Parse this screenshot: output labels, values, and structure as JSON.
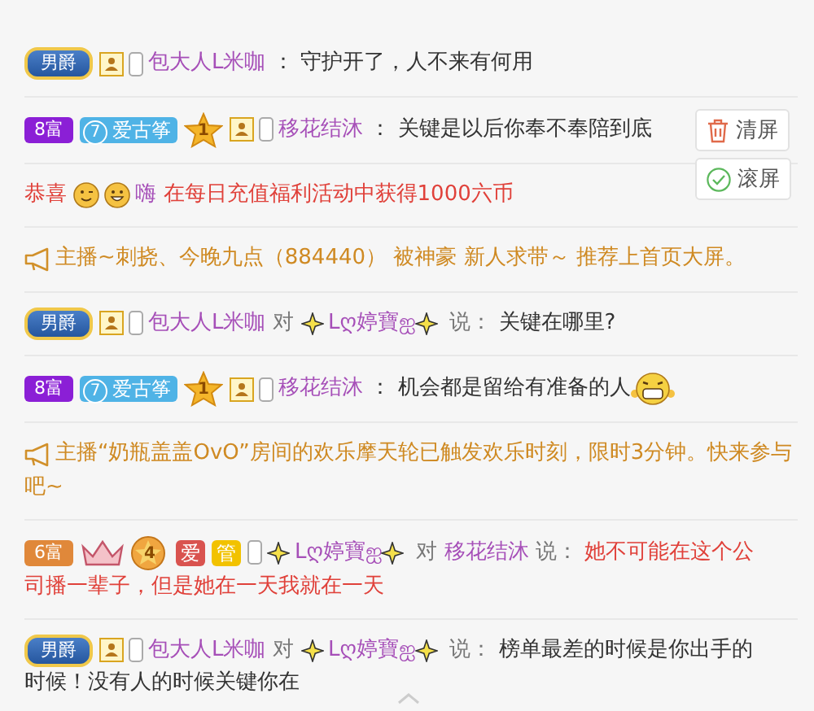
{
  "side_buttons": [
    {
      "label": "清屏"
    },
    {
      "label": "滚屏"
    }
  ],
  "messages": [
    {
      "kind": "chat",
      "badges": [
        {
          "kind": "noble",
          "text": "男爵"
        },
        {
          "kind": "guard"
        },
        {
          "kind": "phone"
        }
      ],
      "user": "包大人L米咖",
      "separator": "：",
      "text": [
        "守护开了，人不来有何用"
      ],
      "highlight": false
    },
    {
      "kind": "chat",
      "badges": [
        {
          "kind": "wealth",
          "text": "8富",
          "color": "#8b1fd6"
        },
        {
          "kind": "fan",
          "level": "7",
          "text": "爱古筝"
        },
        {
          "kind": "star",
          "text": "1"
        },
        {
          "kind": "guard"
        },
        {
          "kind": "phone"
        }
      ],
      "user": "移花结沐",
      "separator": "：",
      "text": [
        "关键是以后你奉不奉陪到底"
      ],
      "highlight": false
    },
    {
      "kind": "gift",
      "prefix": "恭喜",
      "user": "嗨",
      "text": "在每日充值福利活动中获得1000六币"
    },
    {
      "kind": "notice",
      "text": [
        "主播~刺挠、今晚九点（884440） 被神豪 新人求带～ 推荐上首页大屏。"
      ]
    },
    {
      "kind": "chat",
      "badges": [
        {
          "kind": "noble",
          "text": "男爵"
        },
        {
          "kind": "guard"
        },
        {
          "kind": "phone"
        }
      ],
      "user": "包大人L米咖",
      "to_word": "对",
      "target": "Lღ婷寶ஐ",
      "target_sparkle": true,
      "separator": "说：",
      "text": [
        "关键在哪里?"
      ],
      "highlight": false
    },
    {
      "kind": "chat",
      "badges": [
        {
          "kind": "wealth",
          "text": "8富",
          "color": "#8b1fd6"
        },
        {
          "kind": "fan",
          "level": "7",
          "text": "爱古筝"
        },
        {
          "kind": "star",
          "text": "1"
        },
        {
          "kind": "guard"
        },
        {
          "kind": "phone"
        }
      ],
      "user": "移花结沐",
      "separator": "：",
      "text": [
        "机会都是留给有准备的人"
      ],
      "highlight": false,
      "emoji": true
    },
    {
      "kind": "notice",
      "text": [
        "主播“奶瓶盖盖OvO”房间的欢乐摩天轮已触发欢乐时刻，限时3分钟。快来参与",
        "吧~"
      ]
    },
    {
      "kind": "chat",
      "badges": [
        {
          "kind": "wealth",
          "text": "6富",
          "color": "#e0883a"
        },
        {
          "kind": "crown"
        },
        {
          "kind": "medal",
          "text": "4"
        },
        {
          "kind": "tag",
          "text": "爱",
          "color": "#d9534f"
        },
        {
          "kind": "tag",
          "text": "管",
          "color": "#f2c200"
        },
        {
          "kind": "phone"
        }
      ],
      "user": "Lღ婷寶ஐ",
      "user_sparkle": true,
      "to_word": "对",
      "target": "移花结沐",
      "separator": "说：",
      "text": [
        "她不可能在这个公",
        "司播一辈子，但是她在一天我就在一天"
      ],
      "highlight": true
    },
    {
      "kind": "chat",
      "badges": [
        {
          "kind": "noble",
          "text": "男爵"
        },
        {
          "kind": "guard"
        },
        {
          "kind": "phone"
        }
      ],
      "user": "包大人L米咖",
      "to_word": "对",
      "target": "Lღ婷寶ஐ",
      "target_sparkle": true,
      "separator": "说：",
      "text": [
        "榜单最差的时候是你出手的",
        "时候！没有人的时候关键你在"
      ],
      "highlight": false
    }
  ]
}
